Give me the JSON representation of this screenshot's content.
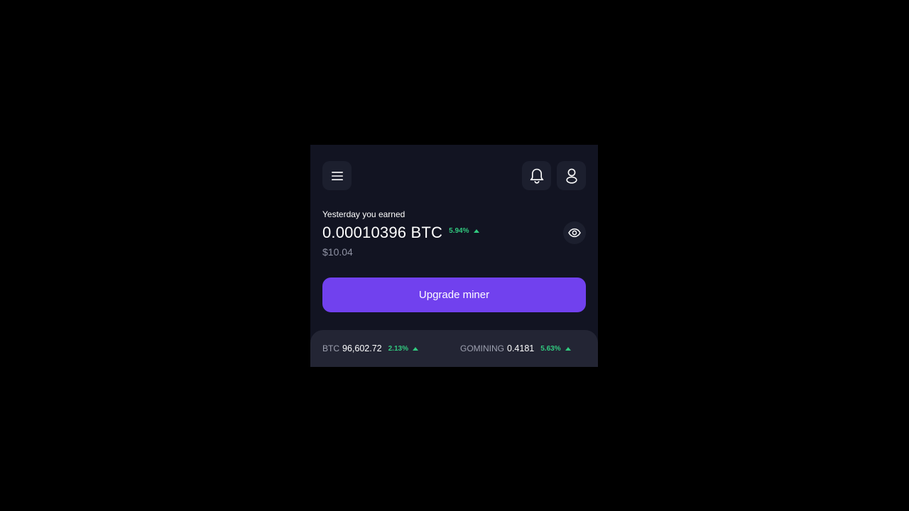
{
  "header": {
    "menu_icon": "hamburger-menu-icon",
    "notifications_icon": "bell-icon",
    "profile_icon": "user-icon"
  },
  "earnings": {
    "label": "Yesterday you earned",
    "amount": "0.00010396 BTC",
    "change": "5.94%",
    "change_direction": "up",
    "usd_value": "$10.04",
    "visibility_icon": "eye-icon"
  },
  "actions": {
    "upgrade_label": "Upgrade miner"
  },
  "ticker": {
    "items": [
      {
        "symbol": "BTC",
        "price": "96,602.72",
        "change": "2.13%",
        "direction": "up"
      },
      {
        "symbol": "GOMINING",
        "price": "0.4181",
        "change": "5.63%",
        "direction": "up"
      }
    ]
  },
  "colors": {
    "page_background": "#000000",
    "app_background": "#121422",
    "card_background": "#1c1f2e",
    "ticker_background": "#232534",
    "accent": "#7141ee",
    "positive": "#31c97f",
    "muted_text": "#8f92a3"
  }
}
